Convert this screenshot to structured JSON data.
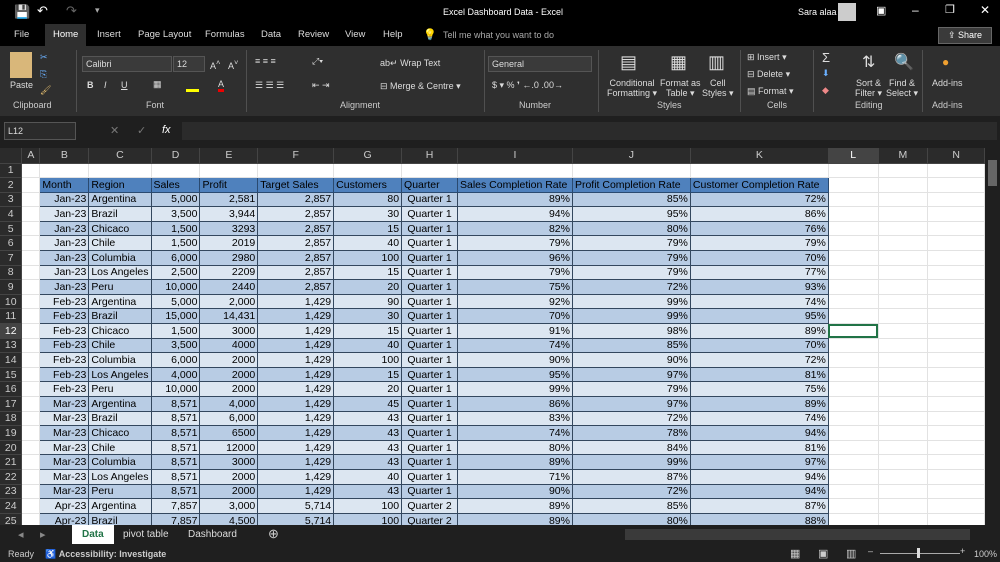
{
  "title": "Excel Dashboard Data  -  Excel",
  "user": "Sara alaa",
  "share": "Share",
  "tabs": [
    "File",
    "Home",
    "Insert",
    "Page Layout",
    "Formulas",
    "Data",
    "Review",
    "View",
    "Help"
  ],
  "tell_me": "Tell me what you want to do",
  "ribbon": {
    "paste": "Paste",
    "font_name": "Calibri",
    "font_size": "12",
    "wrap": "Wrap Text",
    "merge": "Merge & Centre",
    "number_format": "General",
    "conditional": "Conditional",
    "formatting": "Formatting",
    "format_as": "Format as",
    "table": "Table",
    "cell": "Cell",
    "styles_btn": "Styles",
    "insert": "Insert",
    "delete": "Delete",
    "format": "Format",
    "sort": "Sort &",
    "filter": "Filter",
    "find": "Find &",
    "select": "Select",
    "addins_btn": "Add-ins",
    "groups": {
      "clipboard": "Clipboard",
      "font": "Font",
      "alignment": "Alignment",
      "number": "Number",
      "styles": "Styles",
      "cells": "Cells",
      "editing": "Editing",
      "addins": "Add-ins"
    }
  },
  "name_box": "L12",
  "fx": "fx",
  "columns": [
    "A",
    "B",
    "C",
    "D",
    "E",
    "F",
    "G",
    "H",
    "I",
    "J",
    "K",
    "L",
    "M",
    "N"
  ],
  "headers": [
    "Month",
    "Region",
    "Sales",
    "Profit",
    "Target Sales",
    "Customers",
    "Quarter",
    "Sales Completion Rate",
    "Profit Completion Rate",
    "Customer Completion Rate"
  ],
  "rows": [
    [
      "Jan-23",
      "Argentina",
      "5,000",
      "2,581",
      "2,857",
      "80",
      "Quarter 1",
      "89%",
      "85%",
      "72%"
    ],
    [
      "Jan-23",
      "Brazil",
      "3,500",
      "3,944",
      "2,857",
      "30",
      "Quarter 1",
      "94%",
      "95%",
      "86%"
    ],
    [
      "Jan-23",
      "Chicaco",
      "1,500",
      "3293",
      "2,857",
      "15",
      "Quarter 1",
      "82%",
      "80%",
      "76%"
    ],
    [
      "Jan-23",
      "Chile",
      "1,500",
      "2019",
      "2,857",
      "40",
      "Quarter 1",
      "79%",
      "79%",
      "79%"
    ],
    [
      "Jan-23",
      "Columbia",
      "6,000",
      "2980",
      "2,857",
      "100",
      "Quarter 1",
      "96%",
      "79%",
      "70%"
    ],
    [
      "Jan-23",
      "Los Angeles",
      "2,500",
      "2209",
      "2,857",
      "15",
      "Quarter 1",
      "79%",
      "79%",
      "77%"
    ],
    [
      "Jan-23",
      "Peru",
      "10,000",
      "2440",
      "2,857",
      "20",
      "Quarter 1",
      "75%",
      "72%",
      "93%"
    ],
    [
      "Feb-23",
      "Argentina",
      "5,000",
      "2,000",
      "1,429",
      "90",
      "Quarter 1",
      "92%",
      "99%",
      "74%"
    ],
    [
      "Feb-23",
      "Brazil",
      "15,000",
      "14,431",
      "1,429",
      "30",
      "Quarter 1",
      "70%",
      "99%",
      "95%"
    ],
    [
      "Feb-23",
      "Chicaco",
      "1,500",
      "3000",
      "1,429",
      "15",
      "Quarter 1",
      "91%",
      "98%",
      "89%"
    ],
    [
      "Feb-23",
      "Chile",
      "3,500",
      "4000",
      "1,429",
      "40",
      "Quarter 1",
      "74%",
      "85%",
      "70%"
    ],
    [
      "Feb-23",
      "Columbia",
      "6,000",
      "2000",
      "1,429",
      "100",
      "Quarter 1",
      "90%",
      "90%",
      "72%"
    ],
    [
      "Feb-23",
      "Los Angeles",
      "4,000",
      "2000",
      "1,429",
      "15",
      "Quarter 1",
      "95%",
      "97%",
      "81%"
    ],
    [
      "Feb-23",
      "Peru",
      "10,000",
      "2000",
      "1,429",
      "20",
      "Quarter 1",
      "99%",
      "79%",
      "75%"
    ],
    [
      "Mar-23",
      "Argentina",
      "8,571",
      "4,000",
      "1,429",
      "45",
      "Quarter 1",
      "86%",
      "97%",
      "89%"
    ],
    [
      "Mar-23",
      "Brazil",
      "8,571",
      "6,000",
      "1,429",
      "43",
      "Quarter 1",
      "83%",
      "72%",
      "74%"
    ],
    [
      "Mar-23",
      "Chicaco",
      "8,571",
      "6500",
      "1,429",
      "43",
      "Quarter 1",
      "74%",
      "78%",
      "94%"
    ],
    [
      "Mar-23",
      "Chile",
      "8,571",
      "12000",
      "1,429",
      "43",
      "Quarter 1",
      "80%",
      "84%",
      "81%"
    ],
    [
      "Mar-23",
      "Columbia",
      "8,571",
      "3000",
      "1,429",
      "43",
      "Quarter 1",
      "89%",
      "99%",
      "97%"
    ],
    [
      "Mar-23",
      "Los Angeles",
      "8,571",
      "2000",
      "1,429",
      "40",
      "Quarter 1",
      "71%",
      "87%",
      "94%"
    ],
    [
      "Mar-23",
      "Peru",
      "8,571",
      "2000",
      "1,429",
      "43",
      "Quarter 1",
      "90%",
      "72%",
      "94%"
    ],
    [
      "Apr-23",
      "Argentina",
      "7,857",
      "3,000",
      "5,714",
      "100",
      "Quarter 2",
      "89%",
      "85%",
      "87%"
    ],
    [
      "Apr-23",
      "Brazil",
      "7,857",
      "4,500",
      "5,714",
      "100",
      "Quarter 2",
      "89%",
      "80%",
      "88%"
    ]
  ],
  "sheets": [
    "Data",
    "pivot table",
    "Dashboard"
  ],
  "status": {
    "ready": "Ready",
    "accessibility": "Accessibility: Investigate",
    "zoom": "100%"
  }
}
